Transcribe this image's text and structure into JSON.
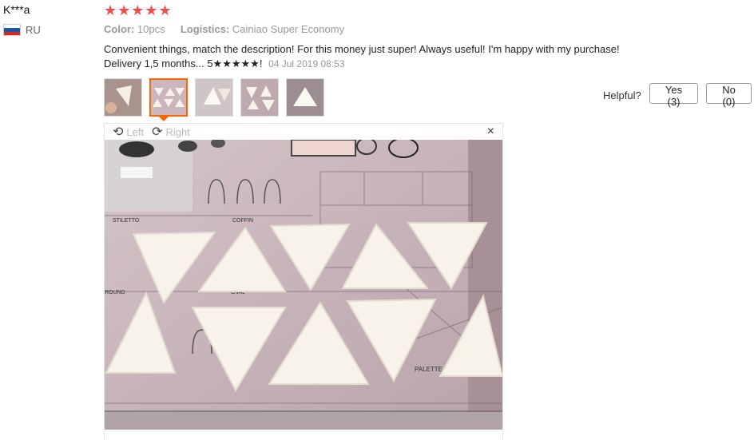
{
  "reviewer": {
    "name": "K***a",
    "country": "RU"
  },
  "rating": {
    "stars": "★★★★★",
    "value": 5
  },
  "meta": {
    "color_label": "Color:",
    "color_value": "10pcs",
    "logistics_label": "Logistics:",
    "logistics_value": "Cainiao Super Economy"
  },
  "review": {
    "line1": "Convenient things, match the description! For this money just super! Always useful! I'm happy with my purchase!",
    "line2": "Delivery 1,5 months... 5★★★★★!",
    "date": "04 Jul 2019 08:53"
  },
  "helpful": {
    "label": "Helpful?",
    "yes": "Yes (3)",
    "no": "No (0)"
  },
  "viewer": {
    "left": "Left",
    "right": "Right",
    "close": "×"
  },
  "photo": {
    "stiletto": "STILETTO",
    "coffin": "COFFIN",
    "round": "ROUND",
    "oval": "OVAL",
    "palette": "PALETTE"
  },
  "colors": {
    "accent": "#f60",
    "stars": "#f44c4c",
    "photo_bg": "#c9b7bd"
  }
}
